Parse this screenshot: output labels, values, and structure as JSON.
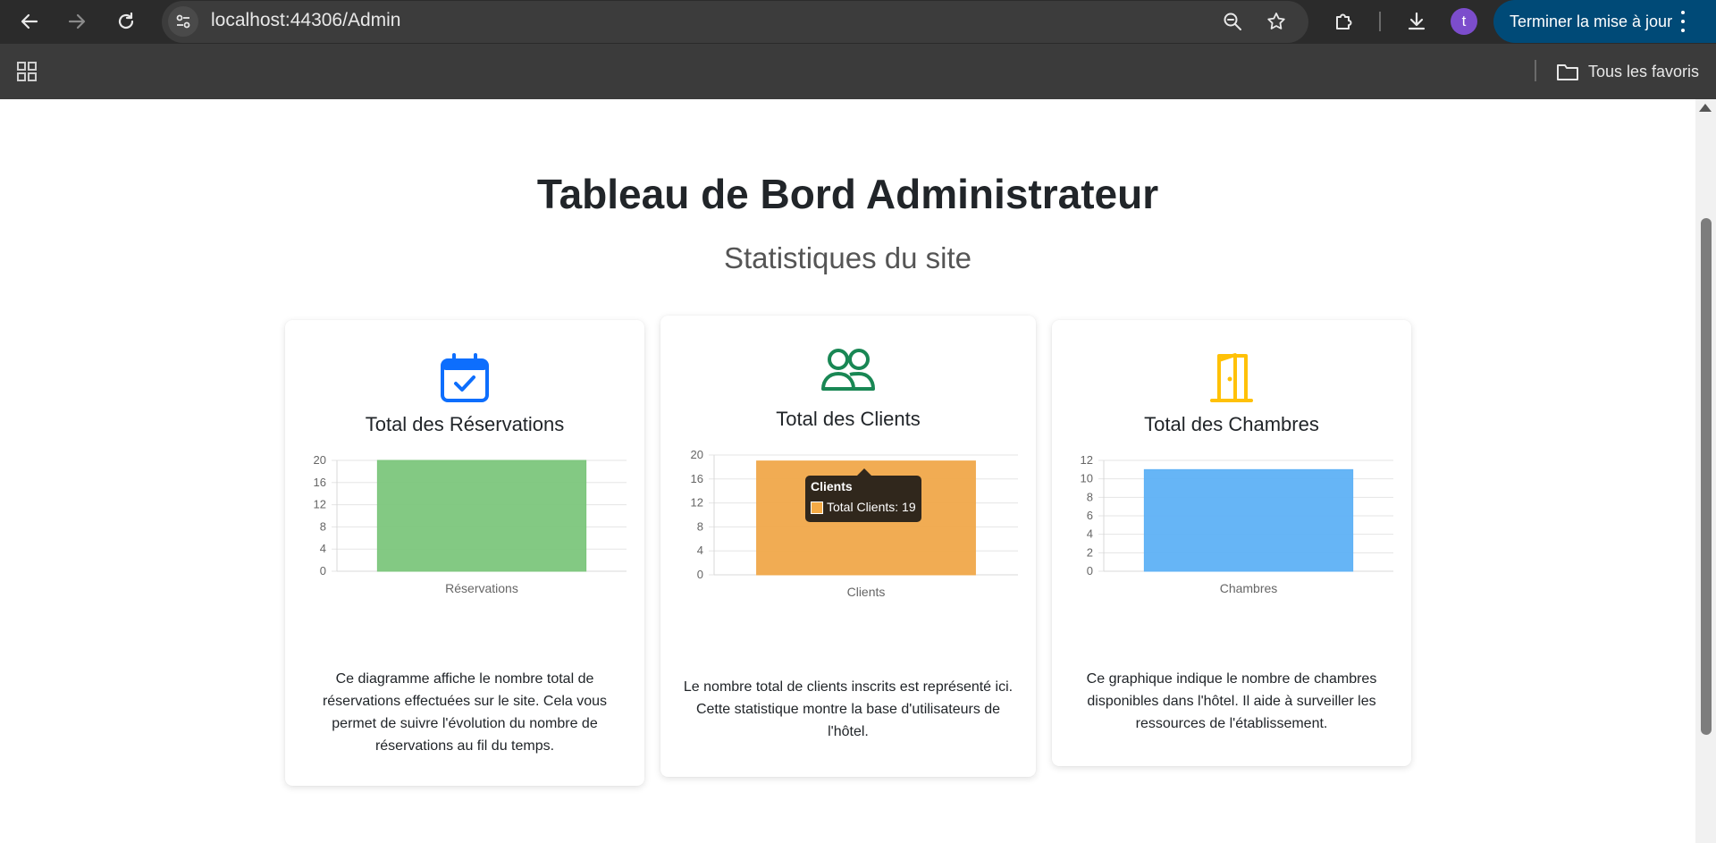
{
  "browser": {
    "url": "localhost:44306/Admin",
    "update_label": "Terminer la mise à jour",
    "avatar_letter": "t",
    "bookmarks_label": "Tous les favoris"
  },
  "page": {
    "title": "Tableau de Bord Administrateur",
    "subtitle": "Statistiques du site"
  },
  "colors": {
    "reservations": "#7cc67c",
    "clients": "#f0a84a",
    "rooms": "#5eb1f5",
    "icon_blue": "#0d6efd",
    "icon_green": "#198754",
    "icon_yellow": "#ffc107"
  },
  "cards": [
    {
      "icon": "calendar-check-icon",
      "title": "Total des Réservations",
      "description": "Ce diagramme affiche le nombre total de réservations effectuées sur le site. Cela vous permet de suivre l'évolution du nombre de réservations au fil du temps."
    },
    {
      "icon": "people-icon",
      "title": "Total des Clients",
      "description": "Le nombre total de clients inscrits est représenté ici. Cette statistique montre la base d'utilisateurs de l'hôtel."
    },
    {
      "icon": "door-icon",
      "title": "Total des Chambres",
      "description": "Ce graphique indique le nombre de chambres disponibles dans l'hôtel. Il aide à surveiller les ressources de l'établissement."
    }
  ],
  "chart_data": [
    {
      "type": "bar",
      "categories": [
        "Réservations"
      ],
      "values": [
        20
      ],
      "ylim": [
        0,
        20
      ],
      "yticks": [
        0,
        4,
        8,
        12,
        16,
        20
      ],
      "color": "#7cc67c"
    },
    {
      "type": "bar",
      "categories": [
        "Clients"
      ],
      "series": [
        {
          "name": "Total Clients",
          "values": [
            19
          ]
        }
      ],
      "ylim": [
        0,
        20
      ],
      "yticks": [
        0,
        4,
        8,
        12,
        16,
        20
      ],
      "color": "#f0a84a",
      "tooltip": {
        "title": "Clients",
        "label": "Total Clients: 19"
      }
    },
    {
      "type": "bar",
      "categories": [
        "Chambres"
      ],
      "values": [
        11
      ],
      "ylim": [
        0,
        12
      ],
      "yticks": [
        0,
        2,
        4,
        6,
        8,
        10,
        12
      ],
      "color": "#5eb1f5"
    }
  ]
}
